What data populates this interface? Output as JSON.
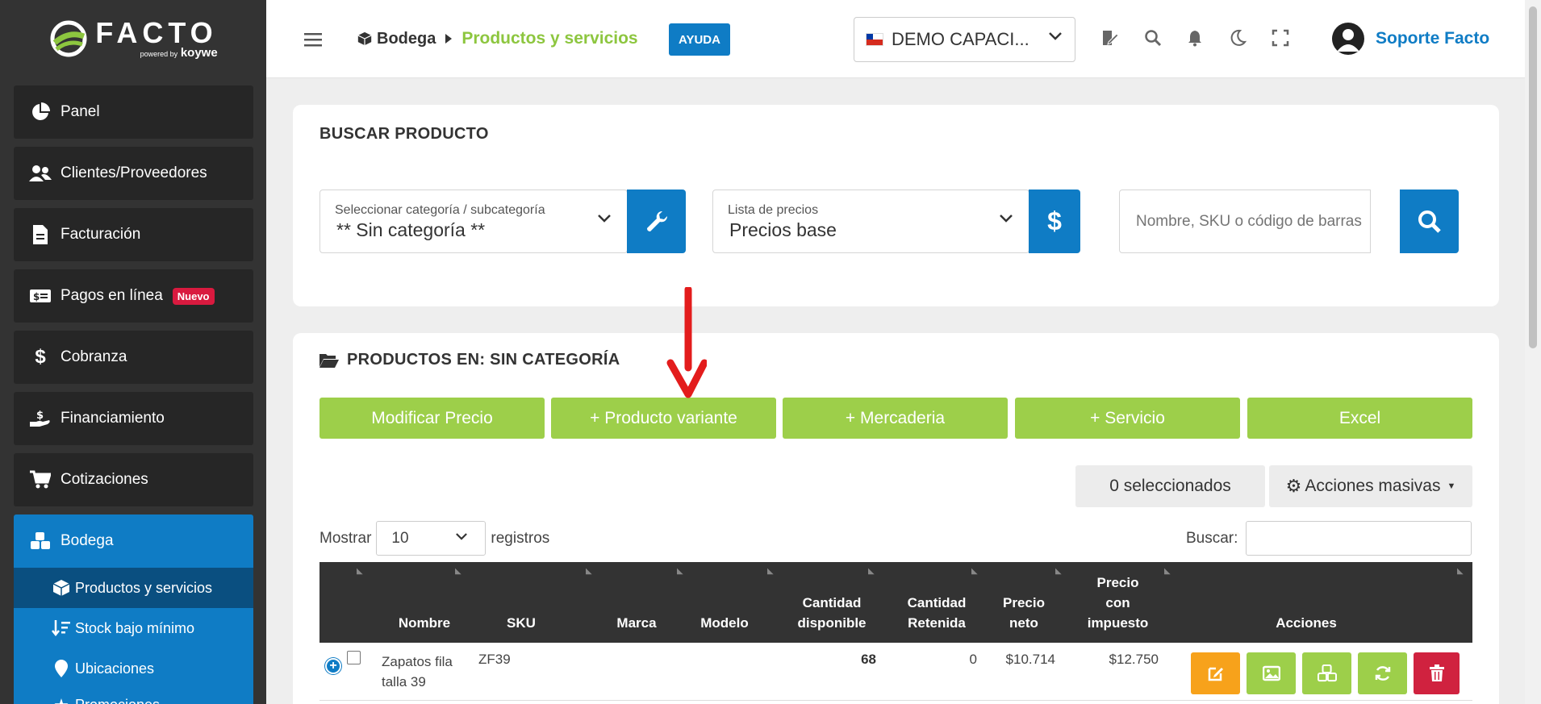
{
  "logo": {
    "text": "FACTO",
    "sub_small": "powered by",
    "sub_brand": "koywe"
  },
  "sidebar": {
    "items": [
      {
        "label": "Panel",
        "icon": "pie-chart-icon"
      },
      {
        "label": "Clientes/Proveedores",
        "icon": "users-icon"
      },
      {
        "label": "Facturación",
        "icon": "document-icon"
      },
      {
        "label": "Pagos en línea",
        "icon": "money-card-icon",
        "badge": "Nuevo"
      },
      {
        "label": "Cobranza",
        "icon": "dollar-icon"
      },
      {
        "label": "Financiamiento",
        "icon": "hand-money-icon"
      },
      {
        "label": "Cotizaciones",
        "icon": "cart-icon"
      }
    ],
    "active": {
      "label": "Bodega",
      "subitems": [
        {
          "label": "Productos y servicios",
          "icon": "box-icon"
        },
        {
          "label": "Stock bajo mínimo",
          "icon": "sort-down-icon"
        },
        {
          "label": "Ubicaciones",
          "icon": "map-pin-icon"
        },
        {
          "label": "Promociones",
          "icon": "star-icon"
        }
      ]
    }
  },
  "topbar": {
    "breadcrumb_root": "Bodega",
    "breadcrumb_current": "Productos y servicios",
    "help_label": "AYUDA",
    "company": "DEMO CAPACI...",
    "user_name": "Soporte Facto"
  },
  "search_card": {
    "title": "BUSCAR PRODUCTO",
    "category_label": "Seleccionar categoría / subcategoría",
    "category_value": "** Sin categoría **",
    "price_label": "Lista de precios",
    "price_value": "Precios base",
    "search_placeholder": "Nombre, SKU o código de barras"
  },
  "products_card": {
    "title": "PRODUCTOS EN: SIN CATEGORÍA",
    "buttons": [
      "Modificar Precio",
      "+ Producto variante",
      "+ Mercaderia",
      "+ Servicio",
      "Excel"
    ],
    "selected_count": "0 seleccionados",
    "bulk_actions": "Acciones masivas",
    "show_label": "Mostrar",
    "show_value": "10",
    "records_label": "registros",
    "search_label": "Buscar:",
    "columns": {
      "nombre": "Nombre",
      "sku": "SKU",
      "marca": "Marca",
      "modelo": "Modelo",
      "cantidad_disp_1": "Cantidad",
      "cantidad_disp_2": "disponible",
      "cantidad_ret_1": "Cantidad",
      "cantidad_ret_2": "Retenida",
      "precio_neto_1": "Precio",
      "precio_neto_2": "neto",
      "precio_imp_1": "Precio",
      "precio_imp_2": "con",
      "precio_imp_3": "impuesto",
      "acciones": "Acciones"
    },
    "rows": [
      {
        "nombre_1": "Zapatos fila",
        "nombre_2": "talla 39",
        "sku": "ZF39",
        "marca": "",
        "modelo": "",
        "cantidad_disponible": "68",
        "cantidad_retenida": "0",
        "precio_neto": "$10.714",
        "precio_impuesto": "$12.750"
      }
    ]
  },
  "colors": {
    "sidebar_bg": "#333333",
    "accent_blue": "#0f7cc5",
    "accent_green": "#9dcf4a",
    "edit_orange": "#f7a21b",
    "delete_red": "#d0223f"
  }
}
